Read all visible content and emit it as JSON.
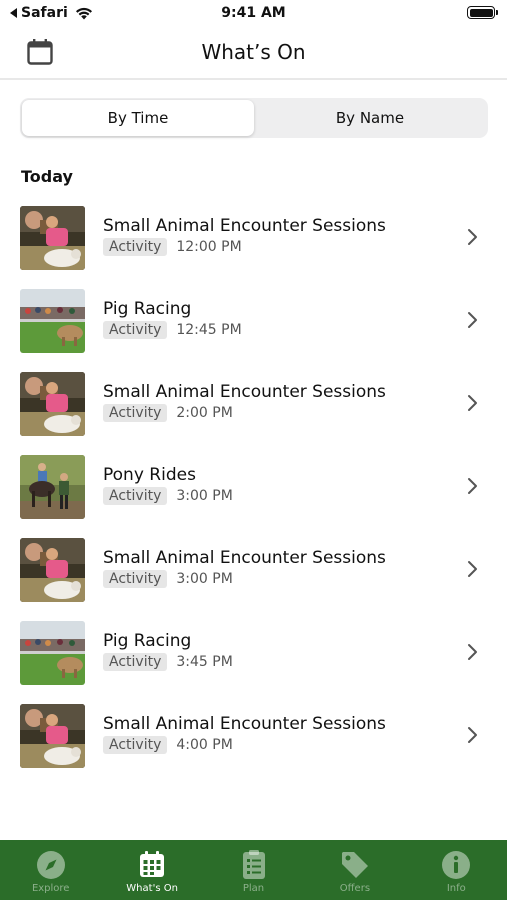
{
  "status_bar": {
    "back_app": "Safari",
    "time": "9:41 AM"
  },
  "header": {
    "title": "What’s On",
    "calendar_icon": "calendar-icon"
  },
  "segmented": {
    "options": [
      "By Time",
      "By Name"
    ],
    "selected": "By Time"
  },
  "section": {
    "title": "Today"
  },
  "events": [
    {
      "title": "Small Animal Encounter Sessions",
      "tag": "Activity",
      "time": "12:00 PM",
      "image": "animal"
    },
    {
      "title": "Pig Racing",
      "tag": "Activity",
      "time": "12:45 PM",
      "image": "pig"
    },
    {
      "title": "Small Animal Encounter Sessions",
      "tag": "Activity",
      "time": "2:00 PM",
      "image": "animal"
    },
    {
      "title": "Pony Rides",
      "tag": "Activity",
      "time": "3:00 PM",
      "image": "pony"
    },
    {
      "title": "Small Animal Encounter Sessions",
      "tag": "Activity",
      "time": "3:00 PM",
      "image": "animal"
    },
    {
      "title": "Pig Racing",
      "tag": "Activity",
      "time": "3:45 PM",
      "image": "pig"
    },
    {
      "title": "Small Animal Encounter Sessions",
      "tag": "Activity",
      "time": "4:00 PM",
      "image": "animal"
    }
  ],
  "tabbar": {
    "items": [
      {
        "label": "Explore",
        "icon": "compass-icon"
      },
      {
        "label": "What's On",
        "icon": "calendar-icon"
      },
      {
        "label": "Plan",
        "icon": "checklist-icon"
      },
      {
        "label": "Offers",
        "icon": "tag-icon"
      },
      {
        "label": "Info",
        "icon": "info-icon"
      }
    ],
    "active": "What's On"
  },
  "colors": {
    "tabbar_bg": "#2b6d29",
    "segment_bg": "#eeeeef",
    "tag_bg": "#e6e6e6"
  }
}
